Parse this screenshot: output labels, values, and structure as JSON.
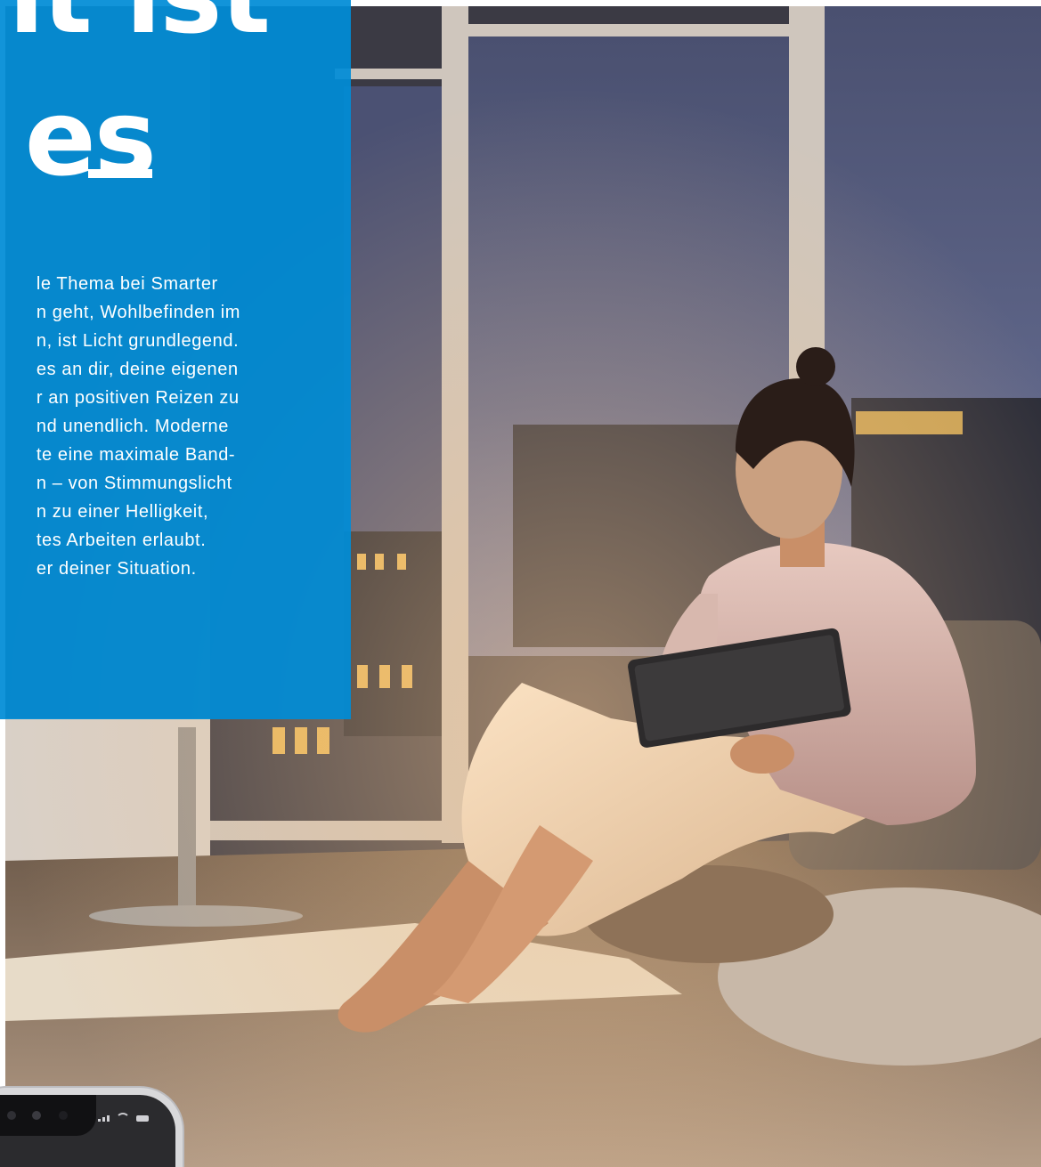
{
  "hero": {
    "headline_line1": "nt ist",
    "headline_line2": "es",
    "body_lines": [
      "le Thema bei Smarter",
      "n geht, Wohlbefinden im",
      "n, ist Licht grundlegend.",
      "es an dir, deine eigenen",
      "r an positiven Reizen zu",
      "nd unendlich. Moderne",
      "te eine maximale Band-",
      "n – von Stimmungslicht",
      "n zu einer Helligkeit,",
      "tes Arbeiten erlaubt.",
      "er deiner Situation."
    ]
  },
  "colors": {
    "panel_blue": "#008CD6",
    "text_white": "#FFFFFF"
  },
  "photo": {
    "subject": "woman-with-tablet-photo"
  },
  "phone": {
    "icons": [
      "signal-icon",
      "wifi-icon",
      "battery-icon"
    ]
  }
}
